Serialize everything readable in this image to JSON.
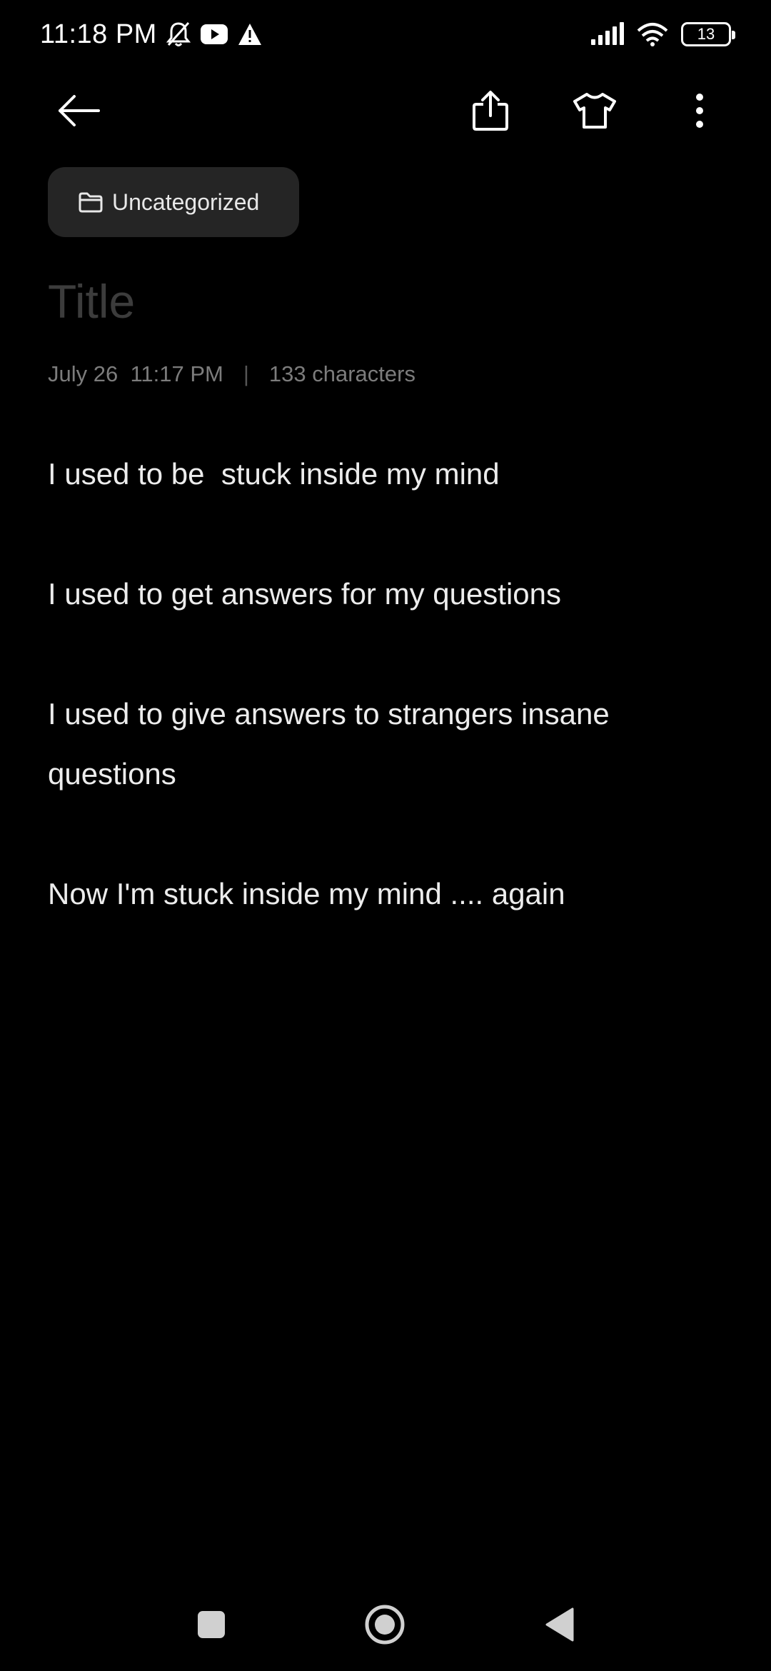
{
  "status_bar": {
    "time": "11:18 PM",
    "battery_level": "13",
    "icons_left": [
      "notifications-muted-icon",
      "youtube-icon",
      "warning-icon"
    ],
    "icons_right": [
      "signal-icon",
      "wifi-icon",
      "battery-icon"
    ]
  },
  "toolbar": {
    "icons": [
      "back-arrow-icon",
      "share-icon",
      "theme-shirt-icon",
      "more-vert-icon"
    ]
  },
  "category": {
    "icon": "folder-icon",
    "label": "Uncategorized"
  },
  "note": {
    "title_placeholder": "Title",
    "date": "July 26  11:17 PM",
    "separator": "|",
    "char_count": "133 characters",
    "lines": [
      "I used to be  stuck inside my mind",
      "",
      "I used to get answers for my questions",
      "",
      "I used to give answers to strangers insane questions",
      "",
      "Now I'm stuck inside my mind .... again"
    ]
  },
  "nav_bar": {
    "icons": [
      "recents-square-icon",
      "home-circle-icon",
      "back-triangle-icon"
    ]
  },
  "colors": {
    "background": "#000000",
    "chip_background": "#252525",
    "text_primary": "#ececec",
    "text_meta": "#7c7c7c",
    "title_placeholder": "#3c3c3c"
  }
}
